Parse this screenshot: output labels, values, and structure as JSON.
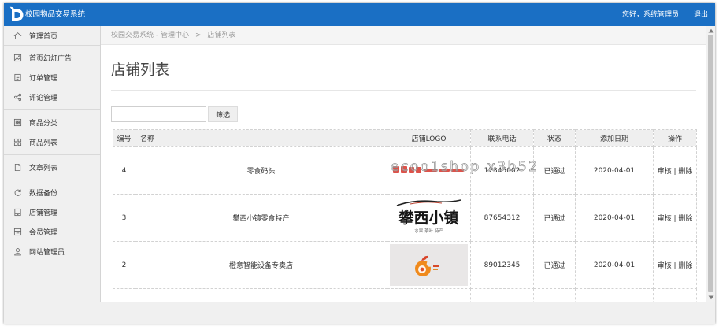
{
  "colors": {
    "header": "#1a6fc4",
    "sidebar_bg": "#f0f0f0",
    "table_header_bg": "#efefef"
  },
  "header": {
    "logo_icon": "campus-logo-icon",
    "app_title": "校园物品交易系统",
    "greeting": "您好，系统管理员",
    "logout": "退出"
  },
  "sidebar": {
    "groups": [
      [
        {
          "label": "管理首页",
          "icon": "home-icon"
        }
      ],
      [
        {
          "label": "首页幻灯广告",
          "icon": "image-icon"
        },
        {
          "label": "订单管理",
          "icon": "list-icon"
        },
        {
          "label": "评论管理",
          "icon": "share-icon"
        }
      ],
      [
        {
          "label": "商品分类",
          "icon": "category-icon"
        },
        {
          "label": "商品列表",
          "icon": "grid-icon"
        }
      ],
      [
        {
          "label": "文章列表",
          "icon": "document-icon"
        }
      ],
      [
        {
          "label": "数据备份",
          "icon": "refresh-icon"
        },
        {
          "label": "店铺管理",
          "icon": "store-icon"
        },
        {
          "label": "会员管理",
          "icon": "member-icon"
        },
        {
          "label": "网站管理员",
          "icon": "user-icon"
        }
      ]
    ]
  },
  "breadcrumb": {
    "root": "校园交易系统 - 管理中心",
    "separator": ">",
    "current": "店铺列表"
  },
  "page_title": "店铺列表",
  "filter": {
    "button_label": "筛选"
  },
  "table": {
    "columns": [
      "编号",
      "名称",
      "店铺LOGO",
      "联系电话",
      "状态",
      "添加日期",
      "操作"
    ],
    "actions": {
      "audit": "审核",
      "separator": "|",
      "delete": "删除"
    },
    "rows": [
      {
        "id": "4",
        "name": "零食码头",
        "logo_icon": "red-lettering-logo",
        "phone": "12345002",
        "status": "已通过",
        "date": "2020-04-01"
      },
      {
        "id": "3",
        "name": "攀西小镇零食特产",
        "logo": {
          "title": "攀西小镇",
          "tagline": "水果 茶叶 特产"
        },
        "phone": "87654312",
        "status": "已通过",
        "date": "2020-04-01"
      },
      {
        "id": "2",
        "name": "橙意智能设备专卖店",
        "logo_icon": "orange-fruit-logo",
        "phone": "89012345",
        "status": "已通过",
        "date": "2020-04-01"
      }
    ]
  },
  "watermark": "ecoo1shop x3b52"
}
